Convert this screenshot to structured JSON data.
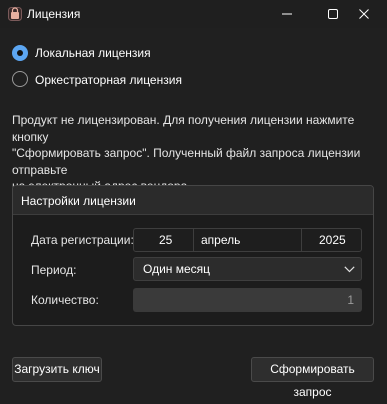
{
  "window": {
    "title": "Лицензия"
  },
  "license_mode": {
    "local_label": "Локальная лицензия",
    "orchestrator_label": "Оркестраторная лицензия",
    "selected": "local"
  },
  "info_text": "Продукт не лицензирован. Для получения лицензии нажмите кнопку\n\"Сформировать запрос\". Полученный файл запроса лицензии отправьте\nна электронный адрес вендора.",
  "settings": {
    "title": "Настройки лицензии",
    "registration_date_label": "Дата регистрации:",
    "date": {
      "day": "25",
      "month": "апрель",
      "year": "2025"
    },
    "period_label": "Период:",
    "period_value": "Один месяц",
    "quantity_label": "Количество:",
    "quantity_value": "1"
  },
  "buttons": {
    "load_key": "Загрузить ключ",
    "make_request": "Сформировать запрос"
  },
  "colors": {
    "accent": "#5ca6f2",
    "background": "#202020",
    "group_header": "#2b2b2b"
  }
}
